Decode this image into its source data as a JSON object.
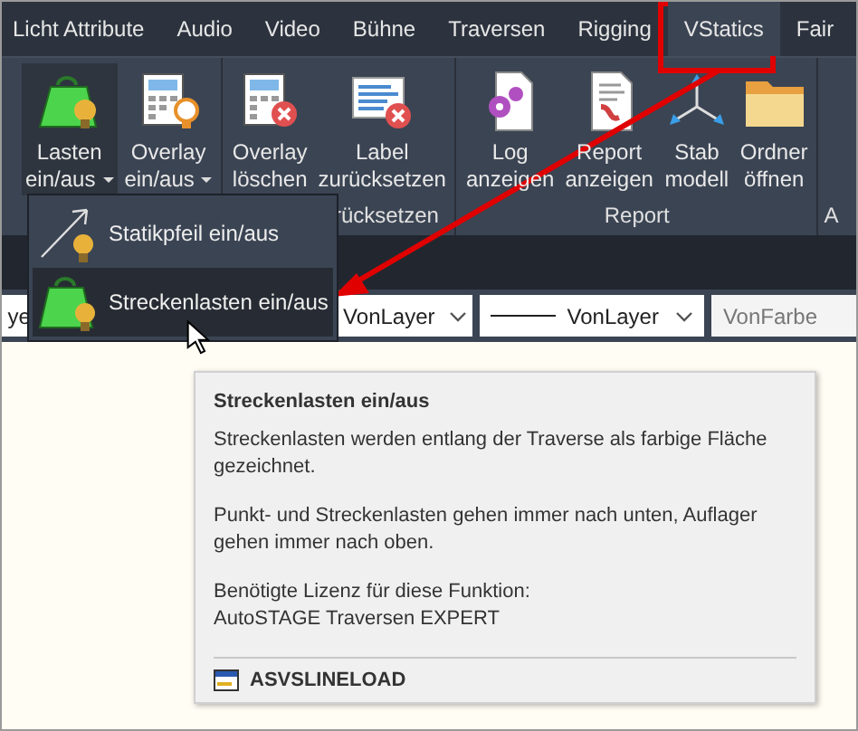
{
  "tabs": [
    {
      "label": "Licht Attribute",
      "selected": false
    },
    {
      "label": "Audio",
      "selected": false
    },
    {
      "label": "Video",
      "selected": false
    },
    {
      "label": "Bühne",
      "selected": false
    },
    {
      "label": "Traversen",
      "selected": false
    },
    {
      "label": "Rigging",
      "selected": false
    },
    {
      "label": "VStatics",
      "selected": true
    },
    {
      "label": "Fair",
      "selected": false
    }
  ],
  "ribbon": {
    "groups": [
      {
        "buttons": [
          {
            "kind": "weight",
            "lines": [
              "Lasten",
              "ein/aus"
            ],
            "dropdown": true,
            "selected": true
          },
          {
            "kind": "overlay",
            "lines": [
              "Overlay",
              "ein/aus"
            ],
            "dropdown": true,
            "selected": false
          }
        ]
      },
      {
        "label": "rücksetzen",
        "buttons": [
          {
            "kind": "overlay-delete",
            "lines": [
              "Overlay",
              "löschen"
            ],
            "dropdown": false,
            "selected": false
          },
          {
            "kind": "label-delete",
            "lines": [
              "Label",
              "zurücksetzen"
            ],
            "dropdown": false,
            "selected": false
          }
        ]
      },
      {
        "label": "Report",
        "buttons": [
          {
            "kind": "log",
            "lines": [
              "Log",
              "anzeigen"
            ],
            "dropdown": false,
            "selected": false
          },
          {
            "kind": "report",
            "lines": [
              "Report",
              "anzeigen"
            ],
            "dropdown": false,
            "selected": false
          },
          {
            "kind": "axes",
            "lines": [
              "Stab",
              "modell"
            ],
            "dropdown": false,
            "selected": false
          },
          {
            "kind": "folder",
            "lines": [
              "Ordner",
              "öffnen"
            ],
            "dropdown": false,
            "selected": false
          }
        ]
      },
      {
        "label": "A"
      }
    ]
  },
  "menu": [
    {
      "kind": "arrow",
      "label": "Statikpfeil ein/aus",
      "selected": false
    },
    {
      "kind": "weight",
      "label": "Streckenlasten ein/aus",
      "selected": true
    }
  ],
  "properties": [
    {
      "kind": "plain",
      "value": "ye"
    },
    {
      "kind": "dropdown",
      "value": "VonLayer"
    },
    {
      "kind": "linetype",
      "value": "VonLayer"
    },
    {
      "kind": "plain",
      "value": "VonFarbe"
    }
  ],
  "tooltip": {
    "title": "Streckenlasten ein/aus",
    "paragraphs": [
      "Streckenlasten werden entlang der Traverse als farbige Fläche gezeichnet.",
      "Punkt- und Streckenlasten gehen immer nach unten, Auflager gehen immer nach oben.",
      "Benötigte Lizenz für diese Funktion:\nAutoSTAGE Traversen EXPERT"
    ],
    "command": "ASVSLINELOAD"
  }
}
